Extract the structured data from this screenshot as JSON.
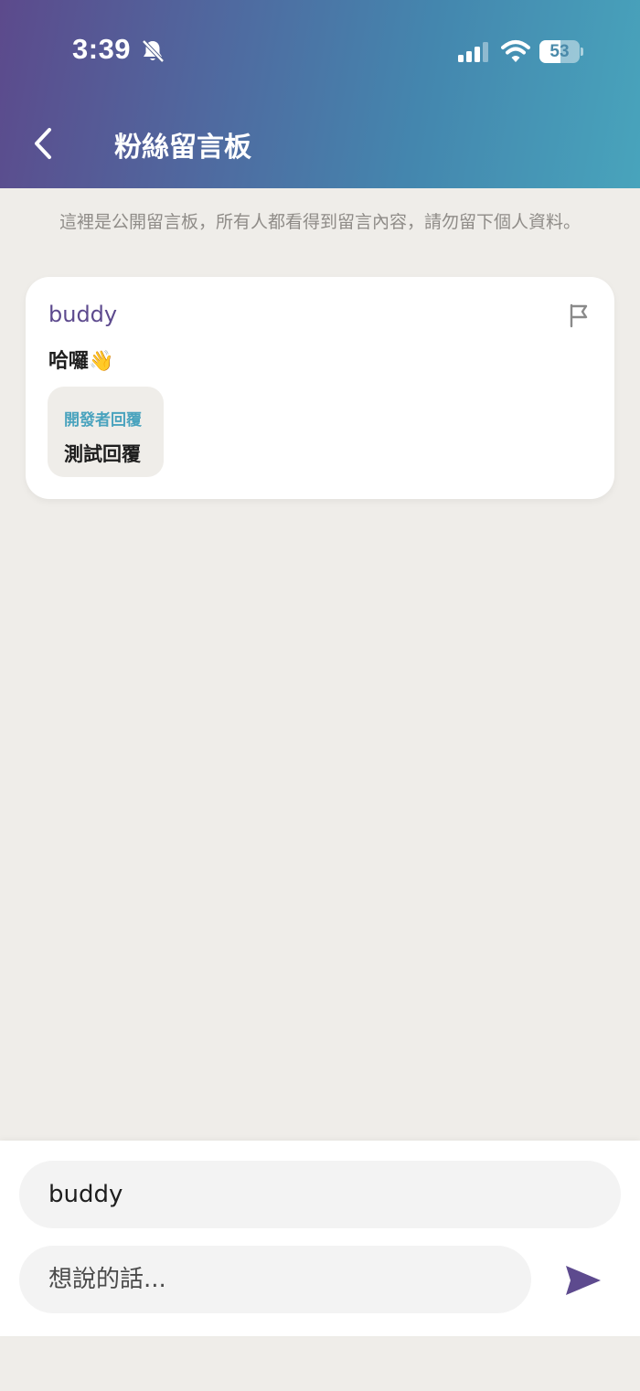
{
  "status_bar": {
    "time": "3:39",
    "battery_level": "53",
    "battery_fraction": 0.53
  },
  "header": {
    "title": "粉絲留言板"
  },
  "notice": "這裡是公開留言板，所有人都看得到留言內容，請勿留下個人資料。",
  "messages": [
    {
      "author": "buddy",
      "text": "哈囉👋",
      "reply": {
        "label": "開發者回覆",
        "text": "測試回覆"
      }
    }
  ],
  "composer": {
    "name_value": "buddy",
    "message_placeholder": "想說的話..."
  },
  "colors": {
    "accent_purple": "#5d4a8e",
    "accent_teal": "#4aa3be",
    "background": "#efede9"
  },
  "icons": {
    "back": "chevron-left-icon",
    "flag": "flag-icon",
    "send": "send-icon",
    "bell_muted": "bell-slash-icon"
  }
}
